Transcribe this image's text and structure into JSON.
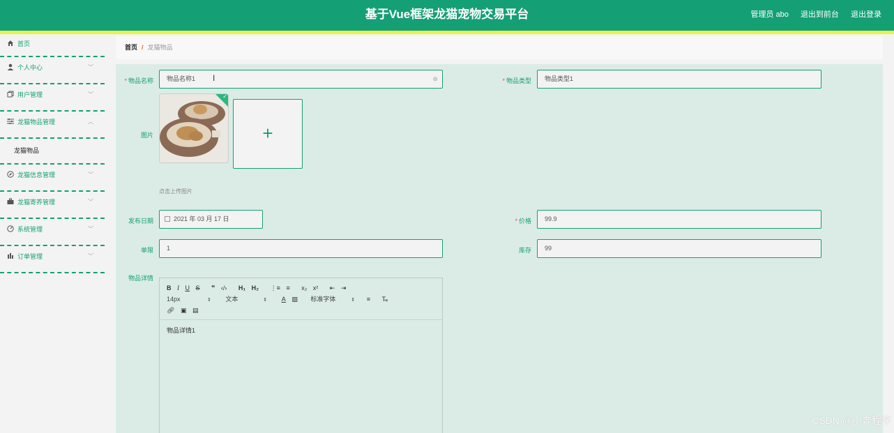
{
  "header": {
    "title": "基于Vue框架龙猫宠物交易平台",
    "user": "管理员 abo",
    "front": "退出到前台",
    "logout": "退出登录"
  },
  "sidebar": {
    "items": [
      {
        "label": "首页",
        "icon": "home-icon"
      },
      {
        "label": "个人中心",
        "icon": "user-icon",
        "arrow": "﹀"
      },
      {
        "label": "用户管理",
        "icon": "copy-icon",
        "arrow": "﹀"
      },
      {
        "label": "龙猫物品管理",
        "icon": "sliders-icon",
        "arrow": "︿"
      },
      {
        "label": "龙猫物品",
        "sub": true
      },
      {
        "label": "龙猫信息管理",
        "icon": "compass-icon",
        "arrow": "﹀"
      },
      {
        "label": "龙猫寄养管理",
        "icon": "briefcase-icon",
        "arrow": "﹀"
      },
      {
        "label": "系统管理",
        "icon": "gauge-icon",
        "arrow": "﹀"
      },
      {
        "label": "订单管理",
        "icon": "chart-icon",
        "arrow": "﹀"
      }
    ]
  },
  "breadcrumb": {
    "home": "首页",
    "sep": "/",
    "current": "龙猫物品"
  },
  "form": {
    "name_label": "物品名称",
    "name_value": "物品名称1",
    "type_label": "物品类型",
    "type_value": "物品类型1",
    "image_label": "图片",
    "upload_tip": "点击上传图片",
    "date_label": "发布日期",
    "date_value": "2021 年 03 月 17 日",
    "price_label": "价格",
    "price_value": "99.9",
    "limit_label": "单限",
    "limit_value": "1",
    "stock_label": "库存",
    "stock_value": "99",
    "detail_label": "物品详情",
    "detail_value": "物品详情1"
  },
  "editor": {
    "font_size": "14px",
    "format": "文本",
    "font_family": "标准字体"
  },
  "colors": {
    "primary": "#149f74",
    "accent_bar": "#e8f24a",
    "form_bg": "#dbece6"
  },
  "watermark": "CSDN @小奔程序"
}
